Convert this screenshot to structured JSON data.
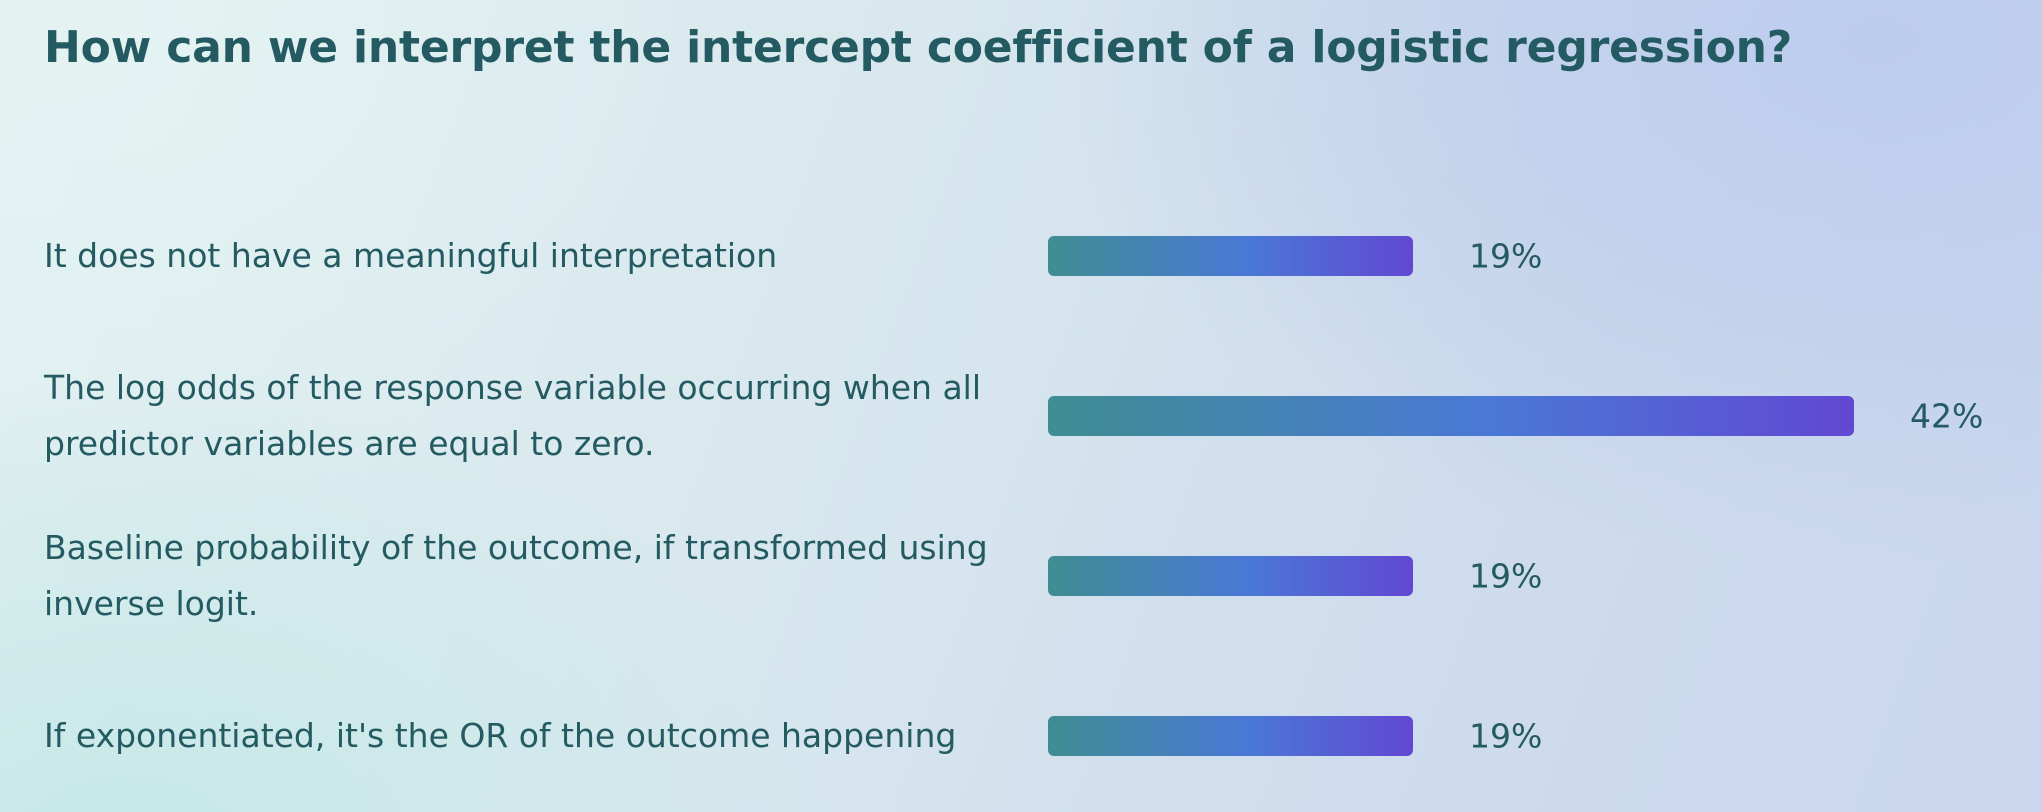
{
  "question": "How can we interpret the intercept coefficient of a logistic regression?",
  "options": [
    {
      "label": "It does not have a meaningful interpretation",
      "percent_label": "19%",
      "value": 19
    },
    {
      "label": "The log odds of the response variable occurring when all predictor variables are equal to zero.",
      "percent_label": "42%",
      "value": 42
    },
    {
      "label": "Baseline probability of the outcome, if transformed using inverse logit.",
      "percent_label": "19%",
      "value": 19
    },
    {
      "label": "If exponentiated, it's the OR of the outcome happening",
      "percent_label": "19%",
      "value": 19
    }
  ],
  "colors": {
    "text": "#245b62",
    "bar_start": "#3f8d92",
    "bar_mid": "#4a78d6",
    "bar_end": "#6148d2"
  }
}
